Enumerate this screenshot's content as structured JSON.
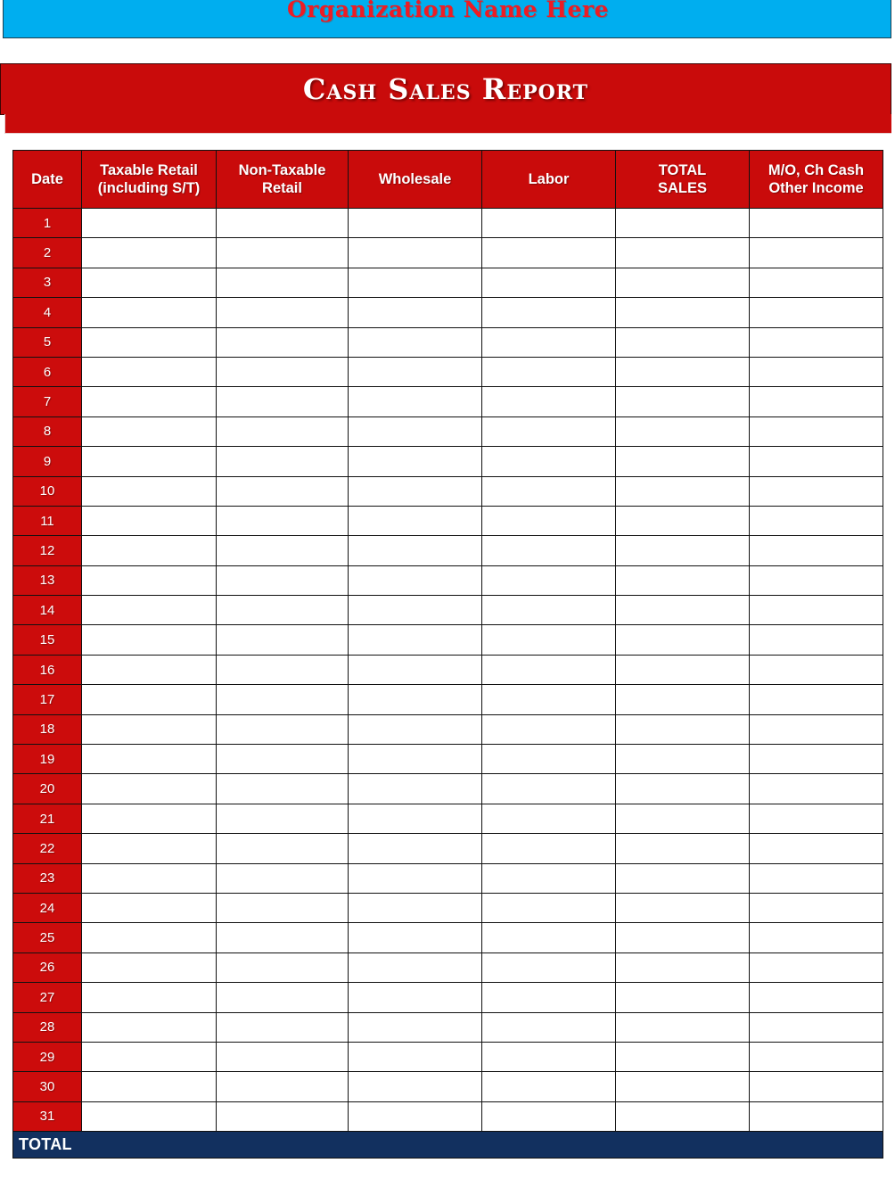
{
  "header": {
    "organization_name": "Organization Name Here",
    "banner_color": "#00AEEF",
    "org_text_color": "#ED1C24"
  },
  "title": {
    "text": "Cash Sales Report",
    "band_color": "#C90B0B",
    "text_color": "#FFFFFF"
  },
  "table": {
    "header_bg": "#C90B0B",
    "date_cell_bg": "#CC0C0C",
    "total_row_bg": "#12305F",
    "columns": [
      {
        "name": "date",
        "line1": "Date",
        "line2": ""
      },
      {
        "name": "taxable-retail",
        "line1": "Taxable Retail",
        "line2": "(including S/T)"
      },
      {
        "name": "non-taxable-retail",
        "line1": "Non-Taxable",
        "line2": "Retail"
      },
      {
        "name": "wholesale",
        "line1": "Wholesale",
        "line2": ""
      },
      {
        "name": "labor",
        "line1": "Labor",
        "line2": ""
      },
      {
        "name": "total-sales",
        "line1": "TOTAL",
        "line2": "SALES"
      },
      {
        "name": "other-income",
        "line1": "M/O, Ch Cash",
        "line2": "Other Income"
      }
    ],
    "rows": [
      {
        "date": "1",
        "values": [
          "",
          "",
          "",
          "",
          "",
          ""
        ]
      },
      {
        "date": "2",
        "values": [
          "",
          "",
          "",
          "",
          "",
          ""
        ]
      },
      {
        "date": "3",
        "values": [
          "",
          "",
          "",
          "",
          "",
          ""
        ]
      },
      {
        "date": "4",
        "values": [
          "",
          "",
          "",
          "",
          "",
          ""
        ]
      },
      {
        "date": "5",
        "values": [
          "",
          "",
          "",
          "",
          "",
          ""
        ]
      },
      {
        "date": "6",
        "values": [
          "",
          "",
          "",
          "",
          "",
          ""
        ]
      },
      {
        "date": "7",
        "values": [
          "",
          "",
          "",
          "",
          "",
          ""
        ]
      },
      {
        "date": "8",
        "values": [
          "",
          "",
          "",
          "",
          "",
          ""
        ]
      },
      {
        "date": "9",
        "values": [
          "",
          "",
          "",
          "",
          "",
          ""
        ]
      },
      {
        "date": "10",
        "values": [
          "",
          "",
          "",
          "",
          "",
          ""
        ]
      },
      {
        "date": "11",
        "values": [
          "",
          "",
          "",
          "",
          "",
          ""
        ]
      },
      {
        "date": "12",
        "values": [
          "",
          "",
          "",
          "",
          "",
          ""
        ]
      },
      {
        "date": "13",
        "values": [
          "",
          "",
          "",
          "",
          "",
          ""
        ]
      },
      {
        "date": "14",
        "values": [
          "",
          "",
          "",
          "",
          "",
          ""
        ]
      },
      {
        "date": "15",
        "values": [
          "",
          "",
          "",
          "",
          "",
          ""
        ]
      },
      {
        "date": "16",
        "values": [
          "",
          "",
          "",
          "",
          "",
          ""
        ]
      },
      {
        "date": "17",
        "values": [
          "",
          "",
          "",
          "",
          "",
          ""
        ]
      },
      {
        "date": "18",
        "values": [
          "",
          "",
          "",
          "",
          "",
          ""
        ]
      },
      {
        "date": "19",
        "values": [
          "",
          "",
          "",
          "",
          "",
          ""
        ]
      },
      {
        "date": "20",
        "values": [
          "",
          "",
          "",
          "",
          "",
          ""
        ]
      },
      {
        "date": "21",
        "values": [
          "",
          "",
          "",
          "",
          "",
          ""
        ]
      },
      {
        "date": "22",
        "values": [
          "",
          "",
          "",
          "",
          "",
          ""
        ]
      },
      {
        "date": "23",
        "values": [
          "",
          "",
          "",
          "",
          "",
          ""
        ]
      },
      {
        "date": "24",
        "values": [
          "",
          "",
          "",
          "",
          "",
          ""
        ]
      },
      {
        "date": "25",
        "values": [
          "",
          "",
          "",
          "",
          "",
          ""
        ]
      },
      {
        "date": "26",
        "values": [
          "",
          "",
          "",
          "",
          "",
          ""
        ]
      },
      {
        "date": "27",
        "values": [
          "",
          "",
          "",
          "",
          "",
          ""
        ]
      },
      {
        "date": "28",
        "values": [
          "",
          "",
          "",
          "",
          "",
          ""
        ]
      },
      {
        "date": "29",
        "values": [
          "",
          "",
          "",
          "",
          "",
          ""
        ]
      },
      {
        "date": "30",
        "values": [
          "",
          "",
          "",
          "",
          "",
          ""
        ]
      },
      {
        "date": "31",
        "values": [
          "",
          "",
          "",
          "",
          "",
          ""
        ]
      }
    ],
    "total_row": {
      "label": "TOTAL",
      "values": [
        "",
        "",
        "",
        "",
        "",
        ""
      ]
    }
  }
}
